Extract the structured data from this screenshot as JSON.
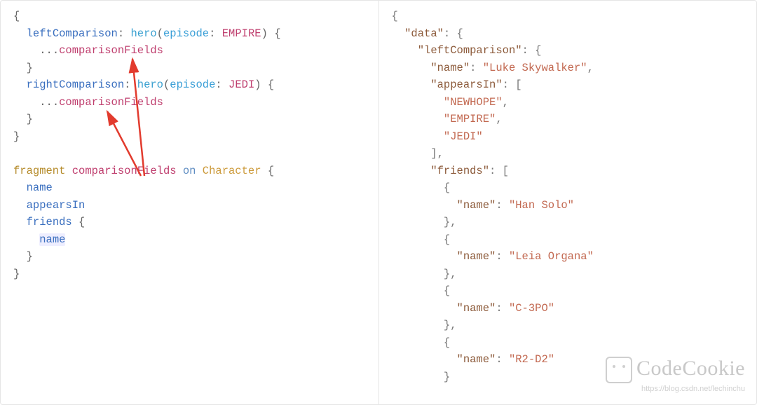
{
  "query": {
    "tokens": {
      "open1": "{",
      "alias1": "leftComparison",
      "colon": ":",
      "hero": "hero",
      "paren_open": "(",
      "episode_label": "episode",
      "EMPIRE": "EMPIRE",
      "paren_close": ")",
      "brace_open": "{",
      "spread": "...",
      "frag_name": "comparisonFields",
      "brace_close": "}",
      "alias2": "rightComparison",
      "JEDI": "JEDI",
      "close1": "}",
      "kw_fragment": "fragment",
      "kw_on": "on",
      "type_character": "Character",
      "field_name": "name",
      "field_appearsIn": "appearsIn",
      "field_friends": "friends"
    }
  },
  "response": {
    "open": "{",
    "data_key": "\"data\"",
    "leftComparison_key": "\"leftComparison\"",
    "name_key": "\"name\"",
    "appearsIn_key": "\"appearsIn\"",
    "friends_key": "\"friends\"",
    "luke": "\"Luke Skywalker\"",
    "newhope": "\"NEWHOPE\"",
    "empire": "\"EMPIRE\"",
    "jedi": "\"JEDI\"",
    "han": "\"Han Solo\"",
    "leia": "\"Leia Organa\"",
    "c3po": "\"C-3PO\"",
    "r2d2": "\"R2-D2\"",
    "br_open": "{",
    "br_close": "}",
    "sq_open": "[",
    "sq_close": "]",
    "colon": ":",
    "comma": ","
  },
  "watermark": {
    "brand": "CodeCookie",
    "url": "https://blog.csdn.net/lechinchu"
  },
  "chart_data": {
    "type": "table",
    "description": "GraphQL query using a fragment, and its JSON response",
    "query_text": "{\n  leftComparison: hero(episode: EMPIRE) {\n    ...comparisonFields\n  }\n  rightComparison: hero(episode: JEDI) {\n    ...comparisonFields\n  }\n}\n\nfragment comparisonFields on Character {\n  name\n  appearsIn\n  friends {\n    name\n  }\n}",
    "response_visible_partial": {
      "data": {
        "leftComparison": {
          "name": "Luke Skywalker",
          "appearsIn": [
            "NEWHOPE",
            "EMPIRE",
            "JEDI"
          ],
          "friends": [
            {
              "name": "Han Solo"
            },
            {
              "name": "Leia Organa"
            },
            {
              "name": "C-3PO"
            },
            {
              "name": "R2-D2"
            }
          ]
        }
      }
    },
    "annotations": [
      "red arrow from 'comparisonFields' fragment definition → first ...comparisonFields spread",
      "red arrow from 'comparisonFields' fragment definition → second ...comparisonFields spread"
    ]
  }
}
